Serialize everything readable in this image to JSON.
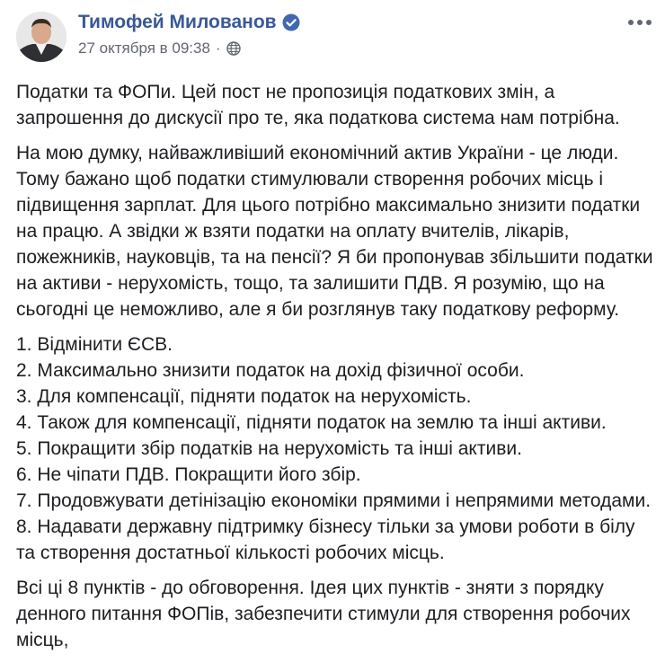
{
  "post": {
    "author": "Тимофей Милованов",
    "timestamp": "27 октября в 09:38",
    "separator": "·",
    "paragraphs": [
      "Податки та ФОПи. Цей пост не пропозиція податкових змін, а запрошення до дискусії про те, яка податкова система нам потрібна.",
      "На мою думку, найважливіший економічний актив України - це люди. Тому бажано щоб податки стимулювали створення робочих місць і підвищення зарплат. Для цього потрібно максимально знизити податки на працю. А звідки ж взяти податки на оплату вчителів, лікарів, пожежників, науковців, та на пенсії? Я би пропонував збільшити податки на активи - нерухомість, тощо, та залишити ПДВ. Я розумію, що на сьогодні це неможливо, але я би розглянув таку податкову реформу."
    ],
    "list": [
      "1. Відмінити ЄСВ.",
      "2. Максимально знизити податок на дохід фізичної особи.",
      "3. Для компенсації, підняти податок на нерухомість.",
      "4. Також для компенсації, підняти податок на землю та інші активи.",
      "5. Покращити збір податків на нерухомість та інші активи.",
      "6. Не чіпати ПДВ. Покращити його збір.",
      "7. Продовжувати детінізацію економіки прямими і непрямими методами.",
      "8. Надавати державну підтримку бізнесу тільки за умови роботи в білу та створення достатньої кількості робочих місць."
    ],
    "closing": "Всі ці 8 пунктів - до обговорення. Ідея цих пунктів - зняти з порядку денного питання ФОПів, забезпечити стимули для створення робочих місць,"
  },
  "icons": {
    "verified": "verified-badge-icon",
    "privacy": "globe-icon",
    "more": "more-options-icon"
  },
  "colors": {
    "author_link": "#385898",
    "verified_badge": "#4267b2",
    "meta_text": "#616770",
    "body_text": "#1c1e21"
  }
}
